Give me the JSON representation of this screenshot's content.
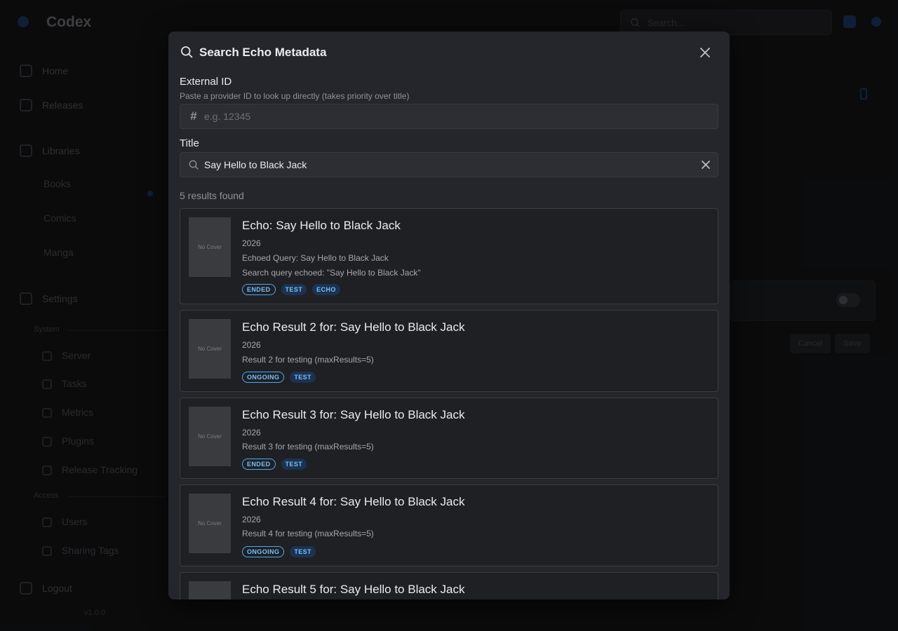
{
  "background": {
    "app_title": "Codex",
    "search_placeholder": "Search...",
    "nav": {
      "home": "Home",
      "releases": "Releases",
      "libraries": "Libraries",
      "library_items": [
        "Books",
        "Comics",
        "Manga"
      ],
      "settings": "Settings",
      "section_system": "System",
      "system_items": [
        "Server",
        "Tasks",
        "Metrics",
        "Plugins",
        "Release Tracking"
      ],
      "section_access": "Access",
      "access_items": [
        "Users",
        "Sharing Tags"
      ],
      "logout": "Logout",
      "version": "v1.0.0"
    },
    "buttons": [
      "Cancel",
      "Save"
    ]
  },
  "modal": {
    "title": "Search Echo Metadata",
    "external_id": {
      "label": "External ID",
      "description": "Paste a provider ID to look up directly (takes priority over title)",
      "placeholder": "e.g. 12345",
      "value": "",
      "prefix_icon": "hash-icon"
    },
    "title_field": {
      "label": "Title",
      "value": "Say Hello to Black Jack",
      "prefix_icon": "search-icon"
    },
    "results_count": "5 results found",
    "results": [
      {
        "cover": "No Cover",
        "title": "Echo: Say Hello to Black Jack",
        "year": "2026",
        "lines": [
          "Echoed Query: Say Hello to Black Jack",
          "Search query echoed: \"Say Hello to Black Jack\""
        ],
        "badges": [
          {
            "text": "ENDED",
            "style": "outline"
          },
          {
            "text": "TEST",
            "style": "light"
          },
          {
            "text": "ECHO",
            "style": "light"
          }
        ]
      },
      {
        "cover": "No Cover",
        "title": "Echo Result 2 for: Say Hello to Black Jack",
        "year": "2026",
        "lines": [
          "Result 2 for testing (maxResults=5)"
        ],
        "badges": [
          {
            "text": "ONGOING",
            "style": "outline"
          },
          {
            "text": "TEST",
            "style": "light"
          }
        ]
      },
      {
        "cover": "No Cover",
        "title": "Echo Result 3 for: Say Hello to Black Jack",
        "year": "2026",
        "lines": [
          "Result 3 for testing (maxResults=5)"
        ],
        "badges": [
          {
            "text": "ENDED",
            "style": "outline"
          },
          {
            "text": "TEST",
            "style": "light"
          }
        ]
      },
      {
        "cover": "No Cover",
        "title": "Echo Result 4 for: Say Hello to Black Jack",
        "year": "2026",
        "lines": [
          "Result 4 for testing (maxResults=5)"
        ],
        "badges": [
          {
            "text": "ONGOING",
            "style": "outline"
          },
          {
            "text": "TEST",
            "style": "light"
          }
        ]
      },
      {
        "cover": "",
        "title": "Echo Result 5 for: Say Hello to Black Jack",
        "year": "",
        "lines": [],
        "badges": []
      }
    ]
  },
  "colors": {
    "accent": "#4dabf7",
    "modal_bg": "#25262b",
    "page_bg": "#141517"
  }
}
